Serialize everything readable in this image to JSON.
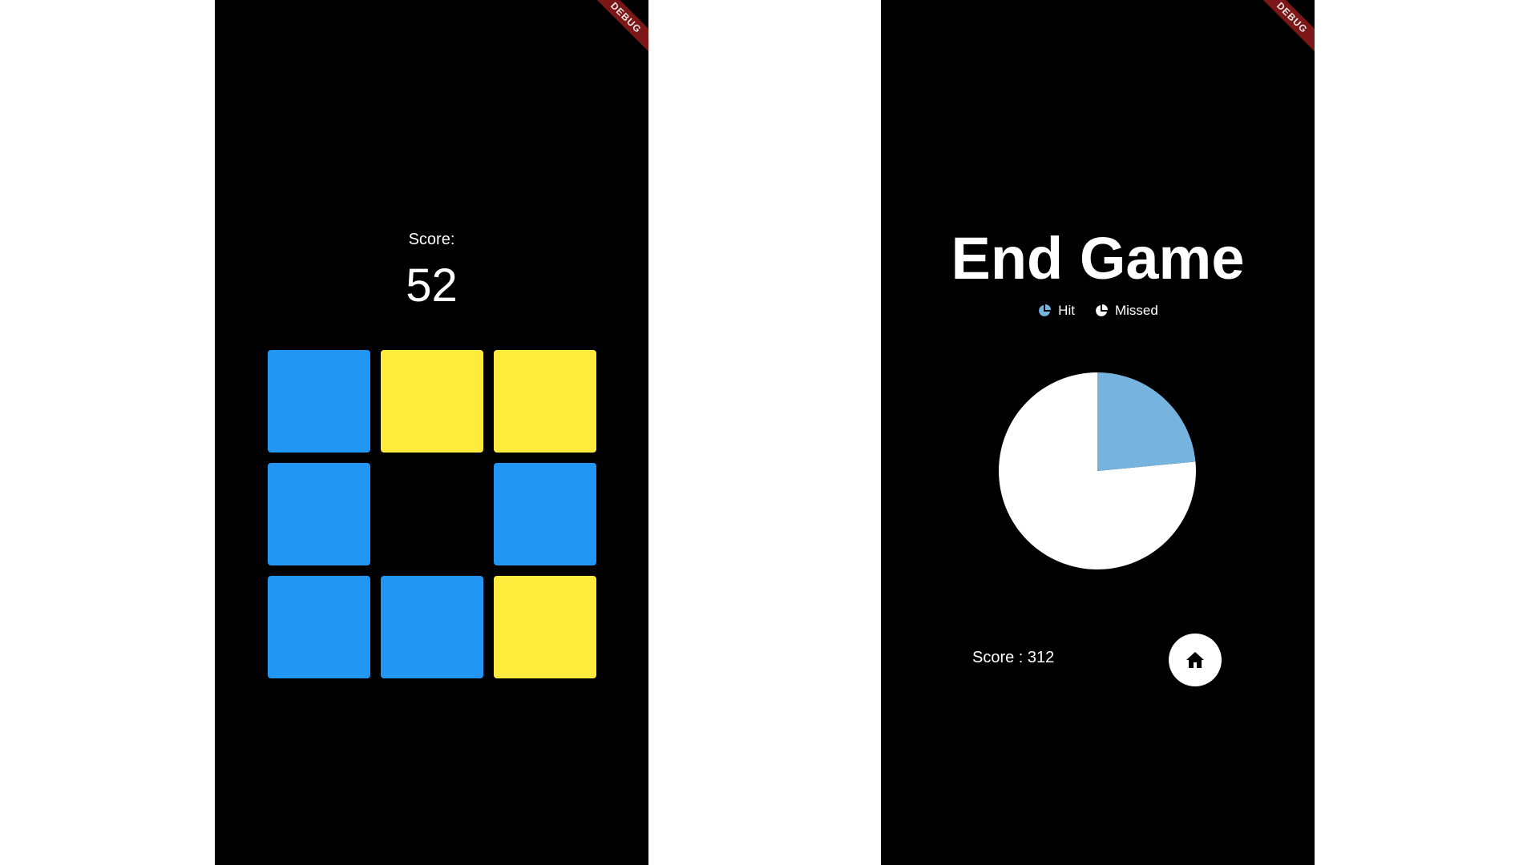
{
  "debug_banner": "DEBUG",
  "game": {
    "score_label": "Score:",
    "score_value": "52",
    "tiles": [
      {
        "color": "blue"
      },
      {
        "color": "yellow"
      },
      {
        "color": "yellow"
      },
      {
        "color": "blue"
      },
      {
        "color": "empty"
      },
      {
        "color": "blue"
      },
      {
        "color": "blue"
      },
      {
        "color": "blue"
      },
      {
        "color": "yellow"
      }
    ]
  },
  "end_screen": {
    "title": "End Game",
    "legend": [
      {
        "label": "Hit",
        "color": "#76b3de"
      },
      {
        "label": "Missed",
        "color": "#ffffff"
      }
    ],
    "pie": {
      "hit_fraction": 0.235,
      "missed_fraction": 0.765
    },
    "score_text": "Score : 312",
    "home_icon": "home-icon"
  },
  "colors": {
    "background": "#000000",
    "blue": "#2196f3",
    "yellow": "#ffeb3b",
    "hit": "#76b3de",
    "missed": "#ffffff",
    "banner": "#8b1a1a"
  }
}
